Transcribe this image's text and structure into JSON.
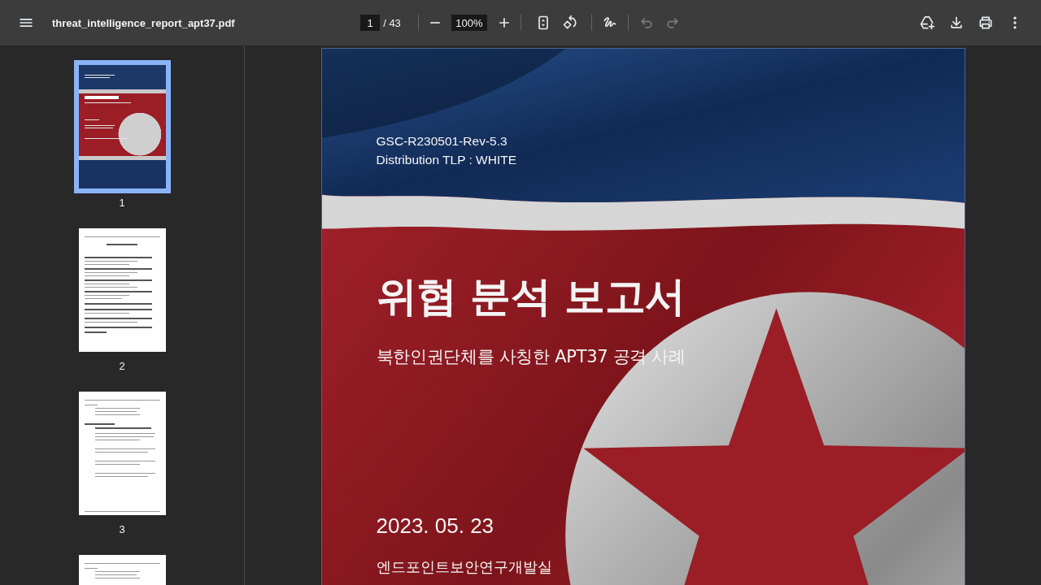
{
  "toolbar": {
    "file_name": "threat_intelligence_report_apt37.pdf",
    "page_input": "1",
    "page_count": "/ 43",
    "zoom_value": "100%",
    "undo": {
      "disabled": true
    },
    "redo": {
      "disabled": true
    }
  },
  "sidebar": {
    "thumbnails": [
      {
        "kind": "cover",
        "page_label": "1",
        "selected": true
      },
      {
        "kind": "contents",
        "page_label": "2",
        "selected": false
      },
      {
        "kind": "body",
        "page_label": "3",
        "selected": false
      },
      {
        "kind": "body",
        "selected": false
      }
    ]
  },
  "document": {
    "code": "GSC-R230501-Rev-5.3",
    "distribution": "Distribution TLP : WHITE",
    "title": "위협 분석 보고서",
    "subtitle": "북한인권단체를 사칭한 APT37 공격 사례",
    "date": "2023. 05. 23",
    "department": "엔드포인트보안연구개발실"
  }
}
